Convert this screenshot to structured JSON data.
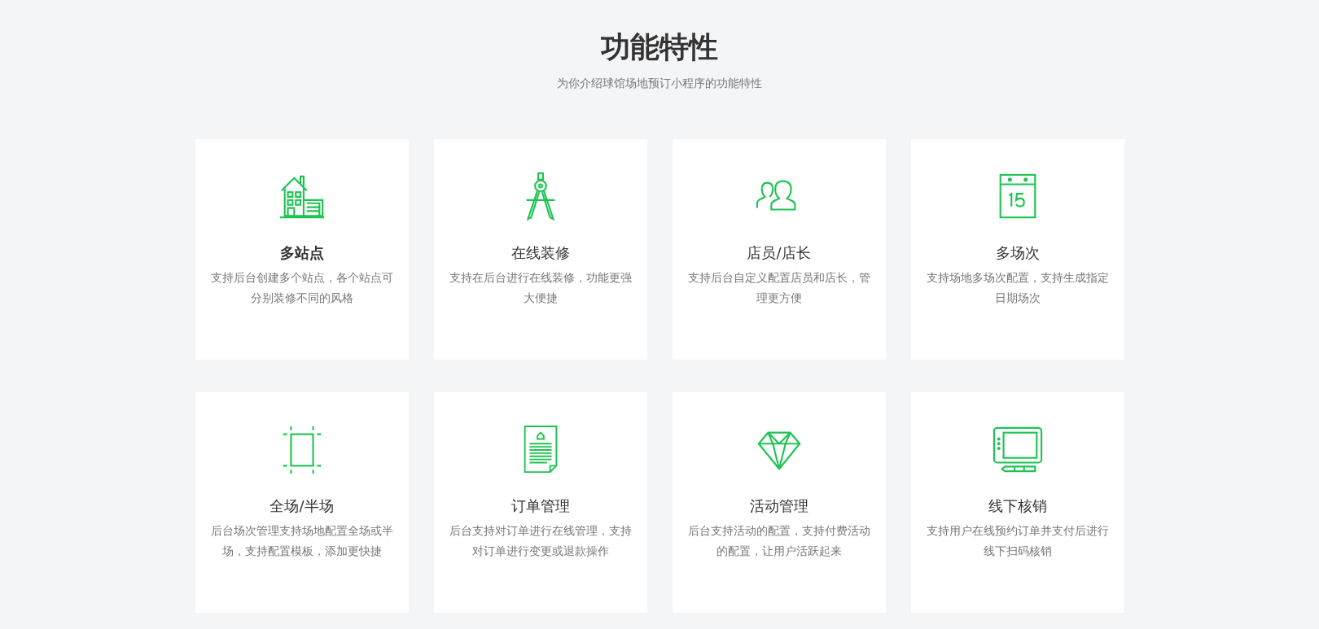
{
  "header": {
    "title": "功能特性",
    "subtitle": "为你介绍球馆场地预订小程序的功能特性"
  },
  "features": [
    {
      "kind": "house",
      "title": "多站点",
      "highlighted": true,
      "description": "支持后台创建多个站点，各个站点可分别装修不同的风格"
    },
    {
      "kind": "compass",
      "title": "在线装修",
      "highlighted": false,
      "description": "支持在后台进行在线装修，功能更强大便捷"
    },
    {
      "kind": "users",
      "title": "店员/店长",
      "highlighted": false,
      "description": "支持后台自定义配置店员和店长，管理更方便"
    },
    {
      "kind": "calendar",
      "title": "多场次",
      "highlighted": false,
      "description": "支持场地多场次配置，支持生成指定日期场次"
    },
    {
      "kind": "crop",
      "title": "全场/半场",
      "highlighted": false,
      "description": "后台场次管理支持场地配置全场或半场，支持配置模板，添加更快捷"
    },
    {
      "kind": "document",
      "title": "订单管理",
      "highlighted": false,
      "description": "后台支持对订单进行在线管理，支持对订单进行变更或退款操作"
    },
    {
      "kind": "diamond",
      "title": "活动管理",
      "highlighted": false,
      "description": "后台支持活动的配置，支持付费活动的配置，让用户活跃起来"
    },
    {
      "kind": "tablet",
      "title": "线下核销",
      "highlighted": false,
      "description": "支持用户在线预约订单并支付后进行线下扫码核销"
    }
  ]
}
